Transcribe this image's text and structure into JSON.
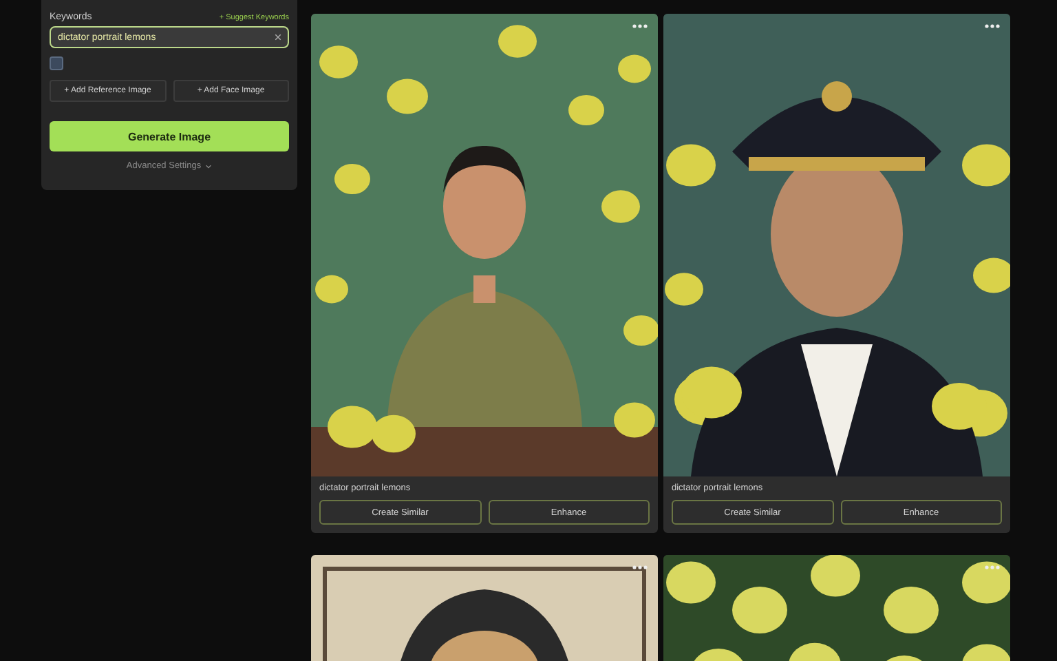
{
  "sidebar": {
    "keywords_label": "Keywords",
    "suggest_link": "+ Suggest Keywords",
    "keyword_field": {
      "value": "dictator portrait lemons"
    },
    "option_checkbox": {
      "checked": false
    },
    "add_buttons": [
      "+ Add Reference Image",
      "+ Add Face Image"
    ],
    "generate_button": "Generate Image",
    "advanced_settings": "Advanced Settings"
  },
  "results": [
    {
      "kind": "picture",
      "caption": "dictator portrait lemons",
      "buttons": [
        "Create Similar",
        "Enhance"
      ]
    },
    {
      "kind": "picture",
      "caption": "dictator portrait lemons",
      "buttons": [
        "Create Similar",
        "Enhance"
      ]
    },
    {
      "kind": "picture"
    },
    {
      "kind": "picture"
    }
  ]
}
